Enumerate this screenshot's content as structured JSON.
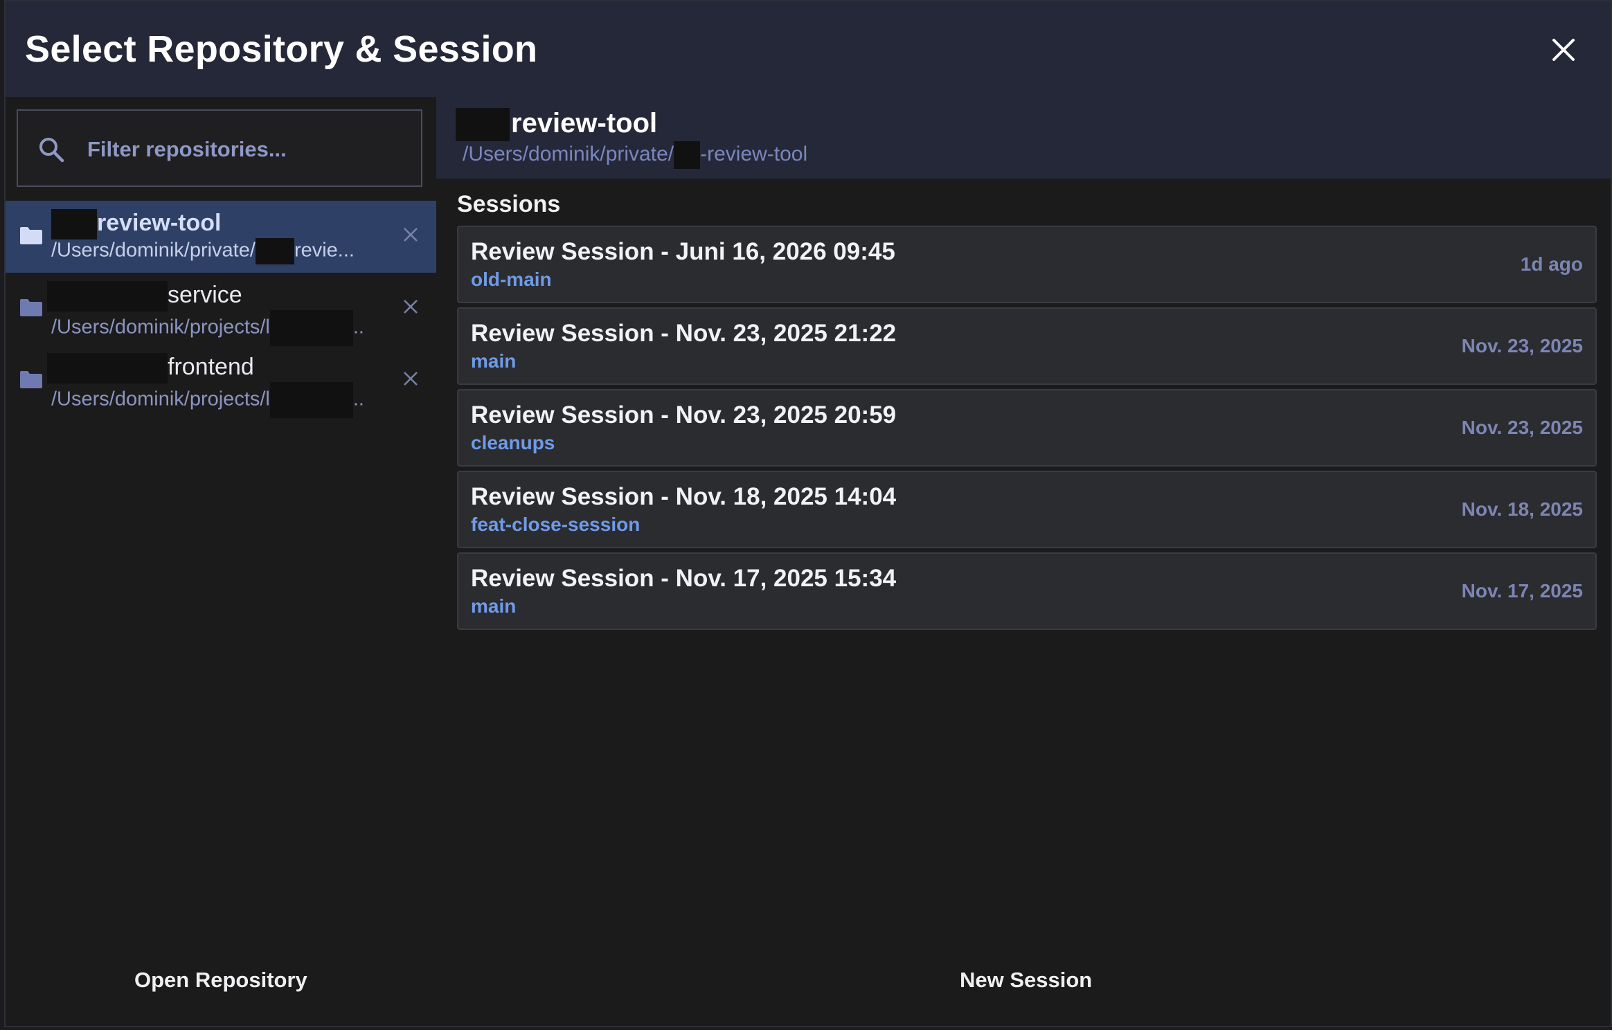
{
  "modal": {
    "title": "Select Repository & Session"
  },
  "search": {
    "placeholder": "Filter repositories..."
  },
  "repositories": [
    {
      "name": "review-tool",
      "path_prefix": "/Users/dominik/private/",
      "path_suffix": "revie...",
      "active": true
    },
    {
      "name": "service",
      "path_prefix": "/Users/dominik/projects/l",
      "path_suffix": "..",
      "active": false
    },
    {
      "name": "frontend",
      "path_prefix": "/Users/dominik/projects/l",
      "path_suffix": "..",
      "active": false
    }
  ],
  "selected_repo": {
    "name": "review-tool",
    "path_prefix": "/Users/dominik/private/",
    "path_suffix": "-review-tool"
  },
  "sessions_heading": "Sessions",
  "sessions": [
    {
      "title": "Review Session - Juni 16, 2026 09:45",
      "branch": "old-main",
      "date": "1d ago"
    },
    {
      "title": "Review Session - Nov. 23, 2025 21:22",
      "branch": "main",
      "date": "Nov. 23, 2025"
    },
    {
      "title": "Review Session - Nov. 23, 2025 20:59",
      "branch": "cleanups",
      "date": "Nov. 23, 2025"
    },
    {
      "title": "Review Session - Nov. 18, 2025 14:04",
      "branch": "feat-close-session",
      "date": "Nov. 18, 2025"
    },
    {
      "title": "Review Session - Nov. 17, 2025 15:34",
      "branch": "main",
      "date": "Nov. 17, 2025"
    }
  ],
  "footer": {
    "open_repository": "Open Repository",
    "new_session": "New Session"
  },
  "icons": {
    "close": "close-icon",
    "search": "search-icon",
    "folder": "folder-icon",
    "remove": "remove-icon"
  },
  "colors": {
    "accent_branch": "#6f9be8",
    "active_item_bg": "#2e4065",
    "header_bg": "#252838"
  }
}
